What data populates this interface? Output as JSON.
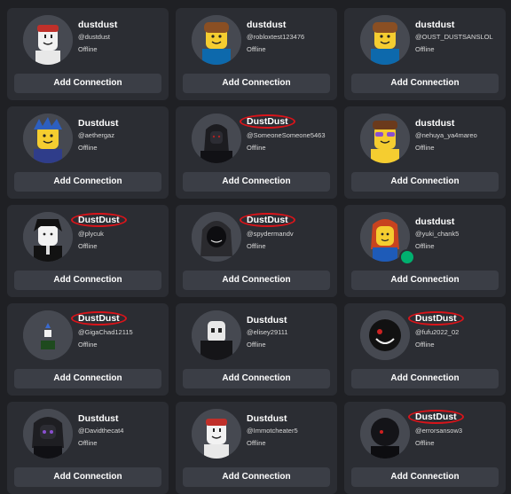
{
  "connections": [
    {
      "name": "dustdust",
      "handle": "@dustdust",
      "status": "Offline",
      "button": "Add Connection",
      "circled": false,
      "avatar": "white-face-red-cap-avatar"
    },
    {
      "name": "dustdust",
      "handle": "@robloxtest123476",
      "status": "Offline",
      "button": "Add Connection",
      "circled": false,
      "avatar": "classic-noob-avatar"
    },
    {
      "name": "dustdust",
      "handle": "@OUST_DUSTSANSLOL",
      "status": "Offline",
      "button": "Add Connection",
      "circled": false,
      "avatar": "classic-noob-avatar"
    },
    {
      "name": "Dustdust",
      "handle": "@aethergaz",
      "status": "Offline",
      "button": "Add Connection",
      "circled": false,
      "avatar": "blue-hair-avatar"
    },
    {
      "name": "DustDust",
      "handle": "@SomeoneSomeone5463",
      "status": "Offline",
      "button": "Add Connection",
      "circled": true,
      "avatar": "dark-hooded-avatar"
    },
    {
      "name": "dustdust",
      "handle": "@nehuya_ya4mareo",
      "status": "Offline",
      "button": "Add Connection",
      "circled": false,
      "avatar": "sunglasses-avatar"
    },
    {
      "name": "DustDust",
      "handle": "@plycuk",
      "status": "Offline",
      "button": "Add Connection",
      "circled": true,
      "avatar": "black-hair-suit-avatar"
    },
    {
      "name": "DustDust",
      "handle": "@spydermandv",
      "status": "Offline",
      "button": "Add Connection",
      "circled": true,
      "avatar": "grey-hood-avatar"
    },
    {
      "name": "dustdust",
      "handle": "@yuki_chank5",
      "status": "Offline",
      "button": "Add Connection",
      "circled": false,
      "avatar": "red-hair-avatar",
      "presence": true
    },
    {
      "name": "DustDust",
      "handle": "@GigaChad12115",
      "status": "Offline",
      "button": "Add Connection",
      "circled": true,
      "avatar": "tiny-green-avatar"
    },
    {
      "name": "Dustdust",
      "handle": "@elisey29111",
      "status": "Offline",
      "button": "Add Connection",
      "circled": false,
      "avatar": "masked-black-avatar"
    },
    {
      "name": "DustDust",
      "handle": "@fufu2022_02",
      "status": "Offline",
      "button": "Add Connection",
      "circled": true,
      "avatar": "black-grin-avatar"
    },
    {
      "name": "Dustdust",
      "handle": "@Davidthecat4",
      "status": "Offline",
      "button": "Add Connection",
      "circled": false,
      "avatar": "purple-eyes-avatar"
    },
    {
      "name": "Dustdust",
      "handle": "@Immotcheater5",
      "status": "Offline",
      "button": "Add Connection",
      "circled": false,
      "avatar": "white-face-red-cap-avatar"
    },
    {
      "name": "DustDust",
      "handle": "@errorsansow3",
      "status": "Offline",
      "button": "Add Connection",
      "circled": true,
      "avatar": "dark-red-eye-avatar"
    }
  ],
  "colors": {
    "background": "#1f2024",
    "card": "#2b2d33",
    "button": "#3b3e46",
    "annotation_circle": "#d9141a",
    "presence": "#00b06f"
  }
}
